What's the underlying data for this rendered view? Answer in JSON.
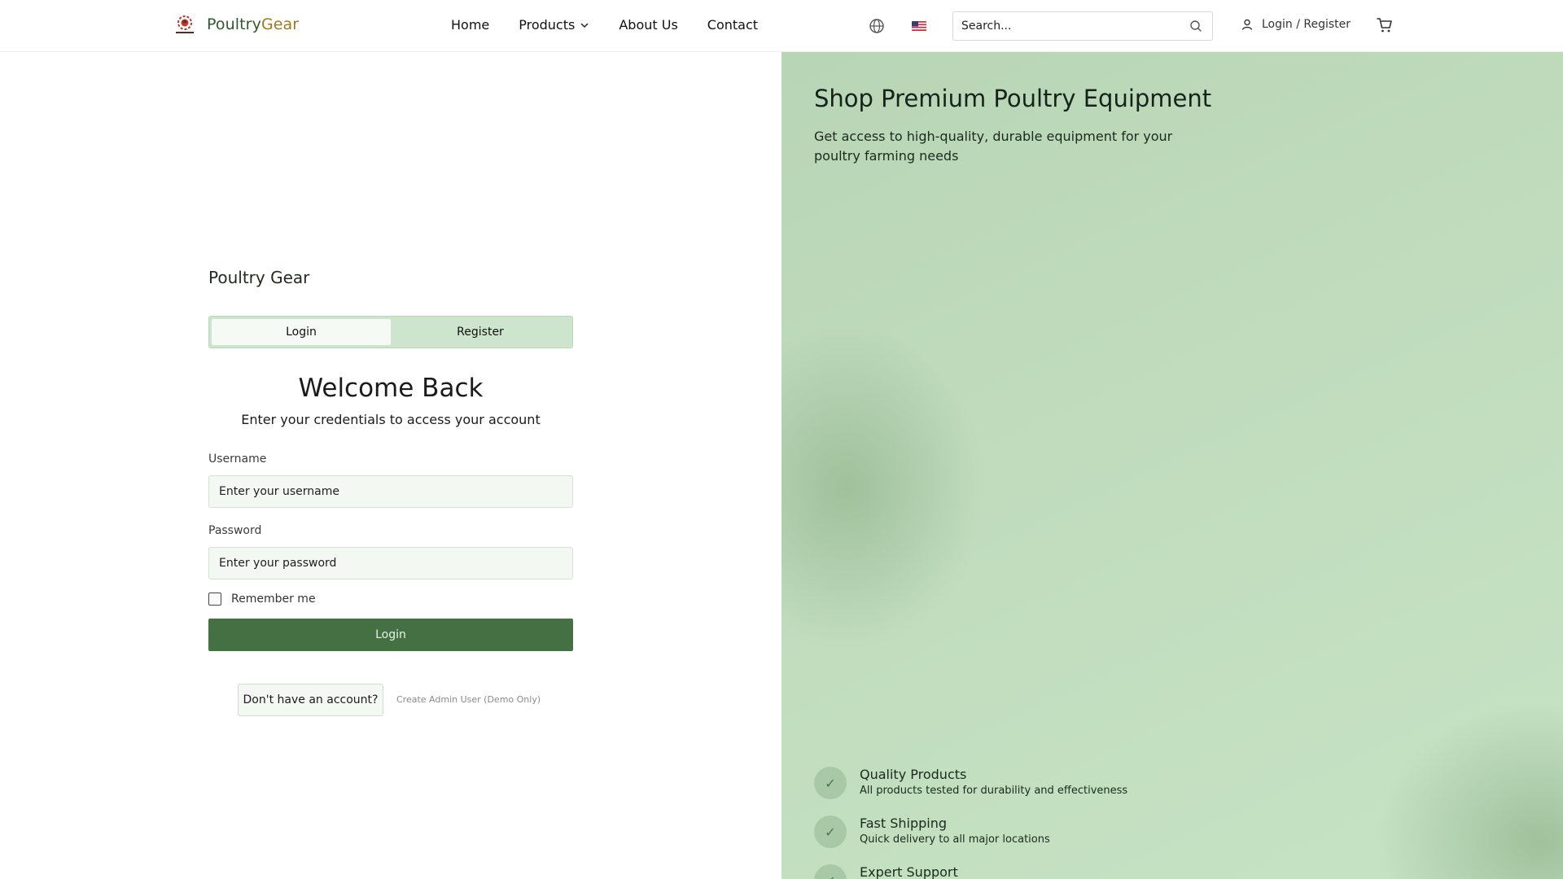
{
  "header": {
    "logo": {
      "text_part1": "Poultry",
      "text_part2": "Gear",
      "icon": "poultry-gear-logo"
    },
    "nav": [
      {
        "label": "Home"
      },
      {
        "label": "Products",
        "icon": "chevron-down-icon"
      },
      {
        "label": "About Us"
      },
      {
        "label": "Contact"
      }
    ],
    "language_icon": "globe-icon",
    "flag_icon": "us-flag-icon",
    "search": {
      "placeholder": "Search...",
      "icon": "search-icon"
    },
    "account": {
      "label": "Login / Register",
      "icon": "user-icon"
    },
    "cart_icon": "cart-icon"
  },
  "auth": {
    "brand_title": "Poultry Gear",
    "tabs": [
      {
        "label": "Login",
        "active": true
      },
      {
        "label": "Register",
        "active": false
      }
    ],
    "heading": "Welcome Back",
    "subheading": "Enter your credentials to access your account",
    "username": {
      "label": "Username",
      "placeholder": "Enter your username",
      "value": ""
    },
    "password": {
      "label": "Password",
      "placeholder": "Enter your password",
      "value": ""
    },
    "remember": {
      "label": "Remember me",
      "checked": false
    },
    "submit_label": "Login",
    "no_account_label": "Don't have an account?",
    "admin_link": "Create Admin User (Demo Only)"
  },
  "promo": {
    "title": "Shop Premium Poultry Equipment",
    "description": "Get access to high-quality, durable equipment for your poultry farming needs",
    "features": [
      {
        "title": "Quality Products",
        "desc": "All products tested for durability and effectiveness",
        "icon": "check-icon"
      },
      {
        "title": "Fast Shipping",
        "desc": "Quick delivery to all major locations",
        "icon": "check-icon"
      },
      {
        "title": "Expert Support",
        "desc": "",
        "icon": "check-icon"
      }
    ]
  },
  "colors": {
    "primary": "#447043",
    "tab_bg": "#cde5cc",
    "panel_bg": "#c0dcbd",
    "brand_gold": "#a07a1a"
  }
}
